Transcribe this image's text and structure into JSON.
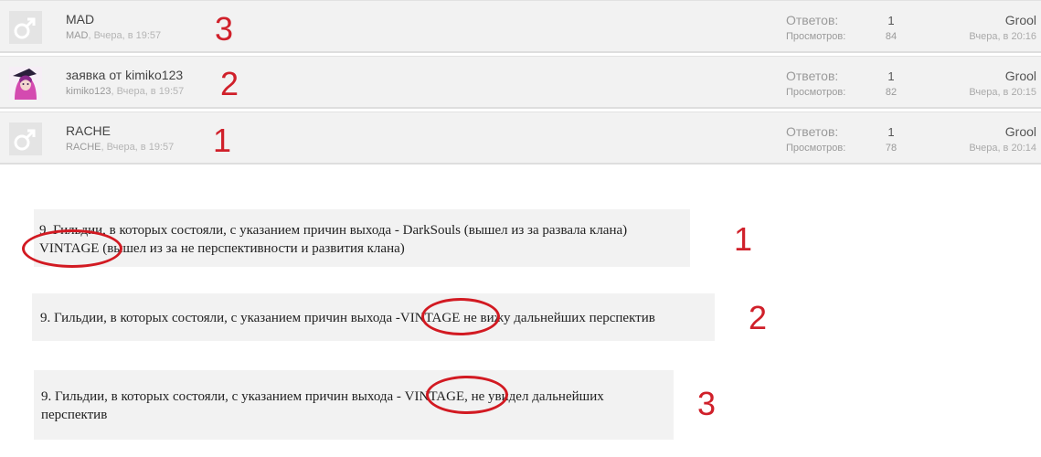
{
  "threads": [
    {
      "title": "MAD",
      "author": "MAD",
      "time": ", Вчера, в 19:57",
      "replies_label": "Ответов:",
      "replies": "1",
      "views_label": "Просмотров:",
      "views": "84",
      "last_user": "Grool",
      "last_time": "Вчера, в 20:16",
      "annotation": "3"
    },
    {
      "title": "заявка от kimiko123",
      "author": "kimiko123",
      "time": ", Вчера, в 19:57",
      "replies_label": "Ответов:",
      "replies": "1",
      "views_label": "Просмотров:",
      "views": "82",
      "last_user": "Grool",
      "last_time": "Вчера, в 20:15",
      "annotation": "2"
    },
    {
      "title": "RACHE",
      "author": "RACHE",
      "time": ", Вчера, в 19:57",
      "replies_label": "Ответов:",
      "replies": "1",
      "views_label": "Просмотров:",
      "views": "78",
      "last_user": "Grool",
      "last_time": "Вчера, в 20:14",
      "annotation": "1"
    }
  ],
  "excerpts": [
    {
      "line1": "9. Гильдии, в которых состояли, с указанием причин выхода - DarkSouls (вышел из за развала клана)",
      "line2": "VINTAGE (вышел из за не перспективности и развития клана)",
      "annotation": "1"
    },
    {
      "line1": "9. Гильдии, в которых состояли, с указанием причин выхода -VINTAGE не вижу дальнейших перспектив",
      "annotation": "2"
    },
    {
      "line1": "9. Гильдии, в которых состояли, с указанием причин выхода - VINTAGE, не увидел дальнейших",
      "line2": "перспектив",
      "annotation": "3"
    }
  ],
  "colors": {
    "row_bg": "#f2f2f2",
    "annotation_red": "#d0202a"
  },
  "icons": {
    "default_avatar": "male-symbol-icon",
    "kimiko_avatar": "anime-girl-avatar"
  }
}
